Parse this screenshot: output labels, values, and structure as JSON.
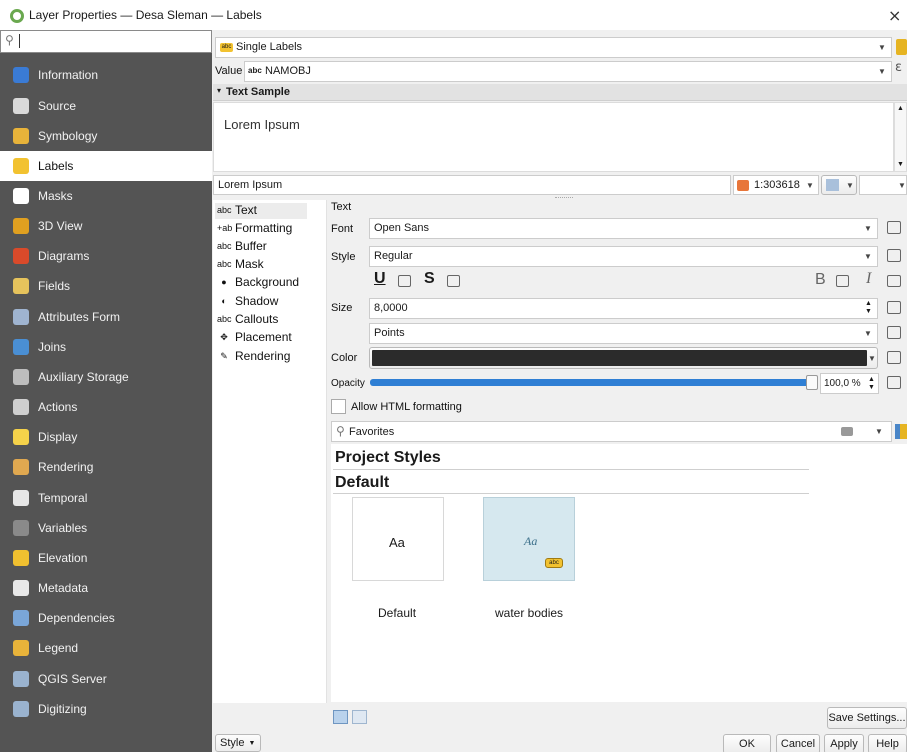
{
  "window": {
    "title": "Layer Properties — Desa Sleman — Labels",
    "close_glyph": "×"
  },
  "sidebar": {
    "search_placeholder": "",
    "items": [
      {
        "label": "Information",
        "icon": "info-icon",
        "color": "#3a7bd5"
      },
      {
        "label": "Source",
        "icon": "source-icon",
        "color": "#d9d9d9"
      },
      {
        "label": "Symbology",
        "icon": "symbology-icon",
        "color": "#e8b33a"
      },
      {
        "label": "Labels",
        "icon": "labels-icon",
        "color": "#f2c230"
      },
      {
        "label": "Masks",
        "icon": "masks-icon",
        "color": "#ffffff"
      },
      {
        "label": "3D View",
        "icon": "3d-view-icon",
        "color": "#e0a020"
      },
      {
        "label": "Diagrams",
        "icon": "diagrams-icon",
        "color": "#d94a2a"
      },
      {
        "label": "Fields",
        "icon": "fields-icon",
        "color": "#e6c35c"
      },
      {
        "label": "Attributes Form",
        "icon": "attributes-form-icon",
        "color": "#9fb4d0"
      },
      {
        "label": "Joins",
        "icon": "joins-icon",
        "color": "#4a8fd4"
      },
      {
        "label": "Auxiliary Storage",
        "icon": "auxiliary-storage-icon",
        "color": "#bdbdbd"
      },
      {
        "label": "Actions",
        "icon": "actions-icon",
        "color": "#cfcfcf"
      },
      {
        "label": "Display",
        "icon": "display-icon",
        "color": "#f5d24a"
      },
      {
        "label": "Rendering",
        "icon": "rendering-icon",
        "color": "#e0a850"
      },
      {
        "label": "Temporal",
        "icon": "temporal-icon",
        "color": "#e6e6e6"
      },
      {
        "label": "Variables",
        "icon": "variables-icon",
        "color": "#8a8a8a"
      },
      {
        "label": "Elevation",
        "icon": "elevation-icon",
        "color": "#f0c030"
      },
      {
        "label": "Metadata",
        "icon": "metadata-icon",
        "color": "#e8e8e8"
      },
      {
        "label": "Dependencies",
        "icon": "dependencies-icon",
        "color": "#7aa6d8"
      },
      {
        "label": "Legend",
        "icon": "legend-icon",
        "color": "#e8b33a"
      },
      {
        "label": "QGIS Server",
        "icon": "qgis-server-icon",
        "color": "#9ab3cf"
      },
      {
        "label": "Digitizing",
        "icon": "digitizing-icon",
        "color": "#9ab3cf"
      }
    ],
    "selected_index": 3
  },
  "labels": {
    "mode": "Single Labels",
    "value_label": "Value",
    "value_badge": "abc",
    "value_field": "NAMOBJ",
    "expression_glyph": "ε",
    "text_sample_header": "Text Sample",
    "text_sample": "Lorem Ipsum",
    "sample_input": "Lorem Ipsum",
    "scale": "1:303618"
  },
  "tabs": [
    {
      "label": "Text",
      "icon": "text-icon",
      "glyph": "abc"
    },
    {
      "label": "Formatting",
      "icon": "formatting-icon",
      "glyph": "+ab"
    },
    {
      "label": "Buffer",
      "icon": "buffer-icon",
      "glyph": "abc"
    },
    {
      "label": "Mask",
      "icon": "mask-icon",
      "glyph": "abc"
    },
    {
      "label": "Background",
      "icon": "background-icon",
      "glyph": "●"
    },
    {
      "label": "Shadow",
      "icon": "shadow-icon",
      "glyph": "◐"
    },
    {
      "label": "Callouts",
      "icon": "callouts-icon",
      "glyph": "abc"
    },
    {
      "label": "Placement",
      "icon": "placement-icon",
      "glyph": "✥"
    },
    {
      "label": "Rendering",
      "icon": "rendering-tab-icon",
      "glyph": "✎"
    }
  ],
  "text_panel": {
    "section_title": "Text",
    "font_label": "Font",
    "font_value": "Open Sans",
    "style_label": "Style",
    "style_value": "Regular",
    "underline": "U",
    "strike": "S",
    "bold": "B",
    "italic": "I",
    "size_label": "Size",
    "size_value": "8,0000",
    "unit_value": "Points",
    "color_label": "Color",
    "color_value": "#2b2b2b",
    "opacity_label": "Opacity",
    "opacity_value": "100,0 %",
    "opacity_fraction": 1.0,
    "html_label": "Allow HTML formatting",
    "favorites_placeholder": "Favorites",
    "project_styles": "Project Styles",
    "default_group": "Default",
    "styles": [
      {
        "name": "Default",
        "preview": "Aa"
      },
      {
        "name": "water bodies",
        "preview": "Aa",
        "badge": "abc"
      }
    ],
    "save_settings": "Save Settings..."
  },
  "footer": {
    "style_menu": "Style",
    "ok": "OK",
    "cancel": "Cancel",
    "apply": "Apply",
    "help": "Help"
  }
}
